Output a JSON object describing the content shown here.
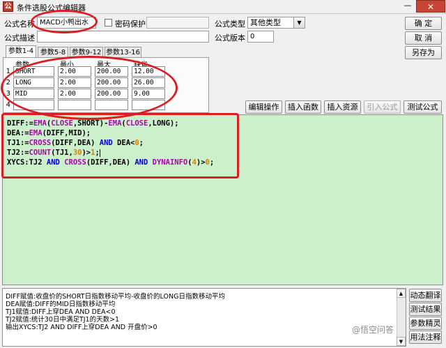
{
  "window": {
    "title": "条件选股公式编辑器",
    "close_glyph": "✕",
    "minimize_glyph": "—",
    "icon_glyph": "公"
  },
  "form": {
    "name_label": "公式名称",
    "name_value": "MACD小鸭出水",
    "password_label": "密码保护",
    "password_value": "",
    "desc_label": "公式描述",
    "desc_value": "",
    "type_label": "公式类型",
    "type_value": "其他类型",
    "version_label": "公式版本",
    "version_value": "0"
  },
  "side_buttons": {
    "ok": "确  定",
    "cancel": "取  消",
    "save_as": "另存为"
  },
  "tabs": [
    "参数1-4",
    "参数5-8",
    "参数9-12",
    "参数13-16"
  ],
  "params": {
    "headers": {
      "name": "参数",
      "min": "最小",
      "max": "最大",
      "default": "缺省"
    },
    "rows": [
      {
        "num": "1",
        "name": "SHORT",
        "min": "2.00",
        "max": "200.00",
        "default": "12.00"
      },
      {
        "num": "2",
        "name": "LONG",
        "min": "2.00",
        "max": "200.00",
        "default": "26.00"
      },
      {
        "num": "3",
        "name": "MID",
        "min": "2.00",
        "max": "200.00",
        "default": "9.00"
      },
      {
        "num": "4",
        "name": "",
        "min": "",
        "max": "",
        "default": ""
      }
    ]
  },
  "toolbar": {
    "edit_ops": "编辑操作",
    "insert_func": "插入函数",
    "insert_res": "插入资源",
    "import_formula": "引入公式",
    "test_formula": "测试公式"
  },
  "code": {
    "line1": "DIFF:=EMA(CLOSE,SHORT)-EMA(CLOSE,LONG);",
    "line2": "DEA:=EMA(DIFF,MID);",
    "line3": "TJ1:=CROSS(DIFF,DEA) AND DEA<0;",
    "line4": "TJ2:=COUNT(TJ1,30)>1;",
    "line5": "XYCS:TJ2 AND CROSS(DIFF,DEA) AND DYNAINFO(4)>0;"
  },
  "notes": {
    "line1": "DIFF赋值:收盘价的SHORT日指数移动平均-收盘价的LONG日指数移动平均",
    "line2": "DEA赋值:DIFF的MID日指数移动平均",
    "line3": "TJ1赋值:DIFF上穿DEA AND DEA<0",
    "line4": "TJ2赋值:统计30日中满足TJ1的天数>1",
    "line5": "输出XYCS:TJ2 AND DIFF上穿DEA AND 开盘价>0"
  },
  "bottom_buttons": {
    "translate": "动态翻译",
    "test_result": "测试结果",
    "param_tune": "参数精灵",
    "usage": "用法注释"
  },
  "watermark": "@悟空问答",
  "colors": {
    "editor_bg": "#ccf0cc",
    "highlight_oval": "#d91e24",
    "keyword": "#0000cc",
    "function": "#b000b0",
    "number": "#d88000"
  }
}
